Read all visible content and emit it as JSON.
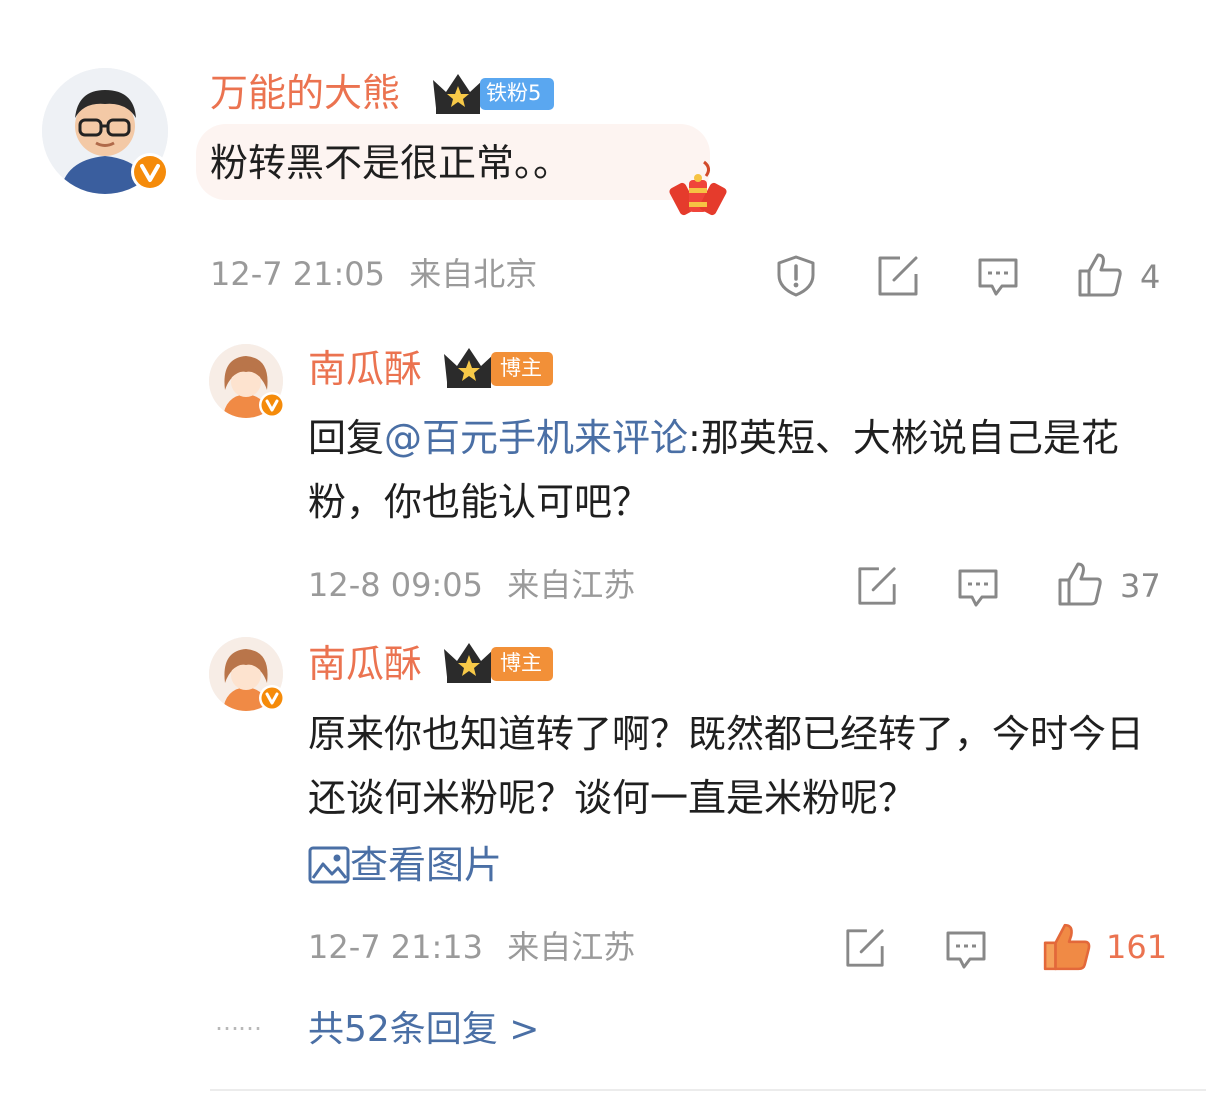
{
  "colors": {
    "username": "#eb7350",
    "link": "#4a6fa5",
    "meta": "#9a9a9a",
    "like_active": "#eb7350",
    "fan_badge": "#5aa7f0",
    "host_badge": "#f29038",
    "verified": "#f58b0a"
  },
  "comment": {
    "username": "万能的大熊",
    "badge": "铁粉5",
    "text": "粉转黑不是很正常。。",
    "time": "12-7 21:05",
    "location": "来自北京",
    "likes": "4",
    "icons": [
      "report-icon",
      "repost-icon",
      "comment-icon",
      "like-icon"
    ]
  },
  "replies": [
    {
      "username": "南瓜酥",
      "badge": "博主",
      "prefix": "回复",
      "mention": "@百元手机来评论",
      "text": ":那英短、大彬说自己是花粉，你也能认可吧？",
      "time": "12-8 09:05",
      "location": "来自江苏",
      "likes": "37"
    },
    {
      "username": "南瓜酥",
      "badge": "博主",
      "text": "原来你也知道转了啊？既然都已经转了，今时今日还谈何米粉呢？谈何一直是米粉呢？",
      "view_image": "查看图片",
      "time": "12-7 21:13",
      "location": "来自江苏",
      "likes": "161"
    }
  ],
  "footer": {
    "dots": "……",
    "more_replies": "共52条回复 >"
  }
}
